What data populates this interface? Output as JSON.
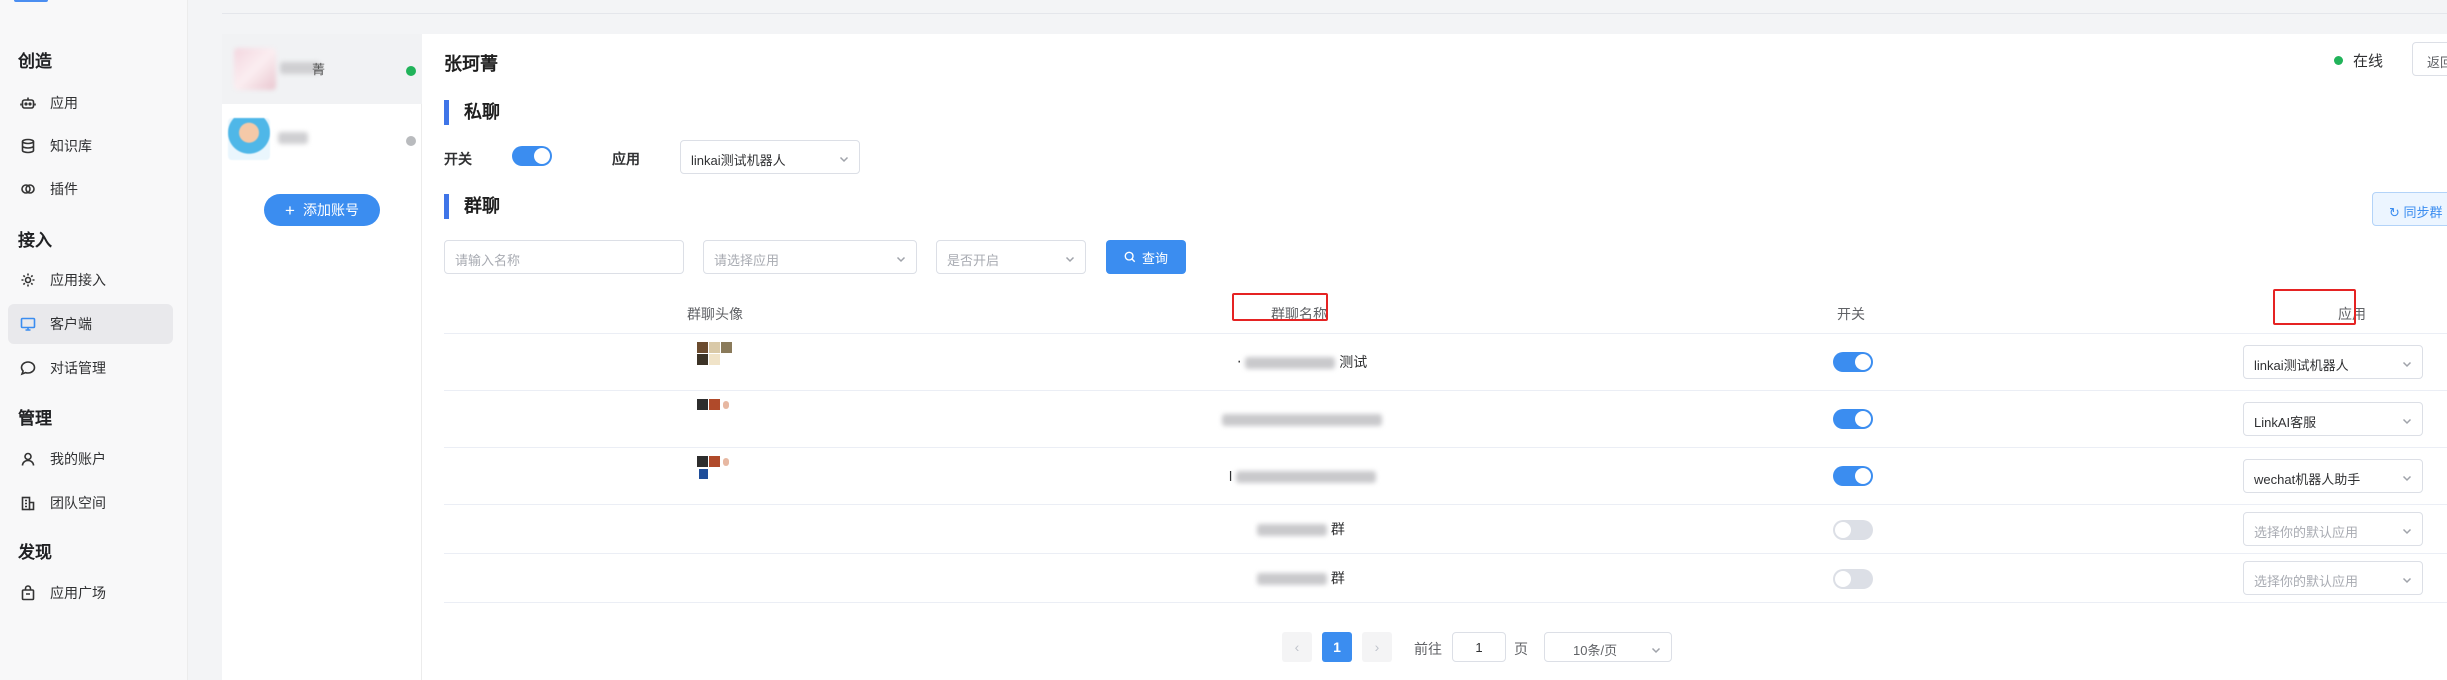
{
  "nav": {
    "sections": [
      {
        "title": "创造",
        "items": [
          {
            "label": "应用",
            "icon": "robot-icon"
          },
          {
            "label": "知识库",
            "icon": "database-icon"
          },
          {
            "label": "插件",
            "icon": "plugin-icon"
          }
        ]
      },
      {
        "title": "接入",
        "items": [
          {
            "label": "应用接入",
            "icon": "gear-icon"
          },
          {
            "label": "客户端",
            "icon": "monitor-icon",
            "active": true
          },
          {
            "label": "对话管理",
            "icon": "chat-icon"
          }
        ]
      },
      {
        "title": "管理",
        "items": [
          {
            "label": "我的账户",
            "icon": "user-icon"
          },
          {
            "label": "团队空间",
            "icon": "building-icon"
          }
        ]
      },
      {
        "title": "发现",
        "items": [
          {
            "label": "应用广场",
            "icon": "store-icon"
          }
        ]
      }
    ]
  },
  "accounts": {
    "items": [
      {
        "name_visible": "菁",
        "status": "online",
        "status_color": "#21b35a",
        "active": true
      },
      {
        "name_visible": "",
        "status": "offline",
        "status_color": "#b9bbbe",
        "active": false
      }
    ],
    "add_label": "添加账号"
  },
  "header": {
    "title": "张珂菁",
    "status_text": "在线",
    "back_label": "返回"
  },
  "private_chat": {
    "section_title": "私聊",
    "switch_label": "开关",
    "switch_on": true,
    "app_label": "应用",
    "app_value": "linkai测试机器人"
  },
  "group_chat": {
    "section_title": "群聊",
    "sync_label": "同步群",
    "filters": {
      "name_placeholder": "请输入名称",
      "app_placeholder": "请选择应用",
      "enabled_placeholder": "是否开启",
      "query_label": "查询"
    },
    "columns": [
      "群聊头像",
      "群聊名称",
      "开关",
      "应用"
    ],
    "highlighted_columns": [
      "群聊名称",
      "应用"
    ],
    "rows": [
      {
        "name_visible": "测试",
        "name_prefix": "‧",
        "switch_on": true,
        "app": "linkai测试机器人",
        "app_is_placeholder": false
      },
      {
        "name_visible": "",
        "switch_on": true,
        "app": "LinkAI客服",
        "app_is_placeholder": false
      },
      {
        "name_visible": "",
        "name_prefix": "l",
        "switch_on": true,
        "app": "wechat机器人助手",
        "app_is_placeholder": false
      },
      {
        "name_visible": "群",
        "switch_on": false,
        "app": "选择你的默认应用",
        "app_is_placeholder": true
      },
      {
        "name_visible": "群",
        "switch_on": false,
        "app": "选择你的默认应用",
        "app_is_placeholder": true
      }
    ]
  },
  "pagination": {
    "prev": "‹",
    "current_page": "1",
    "next": "›",
    "goto_label": "前往",
    "goto_value": "1",
    "page_suffix": "页",
    "page_size": "10条/页"
  },
  "colors": {
    "accent": "#3b8df0",
    "section_bar": "#3f75e8",
    "online": "#21b35a",
    "highlight_box": "#e52323"
  }
}
